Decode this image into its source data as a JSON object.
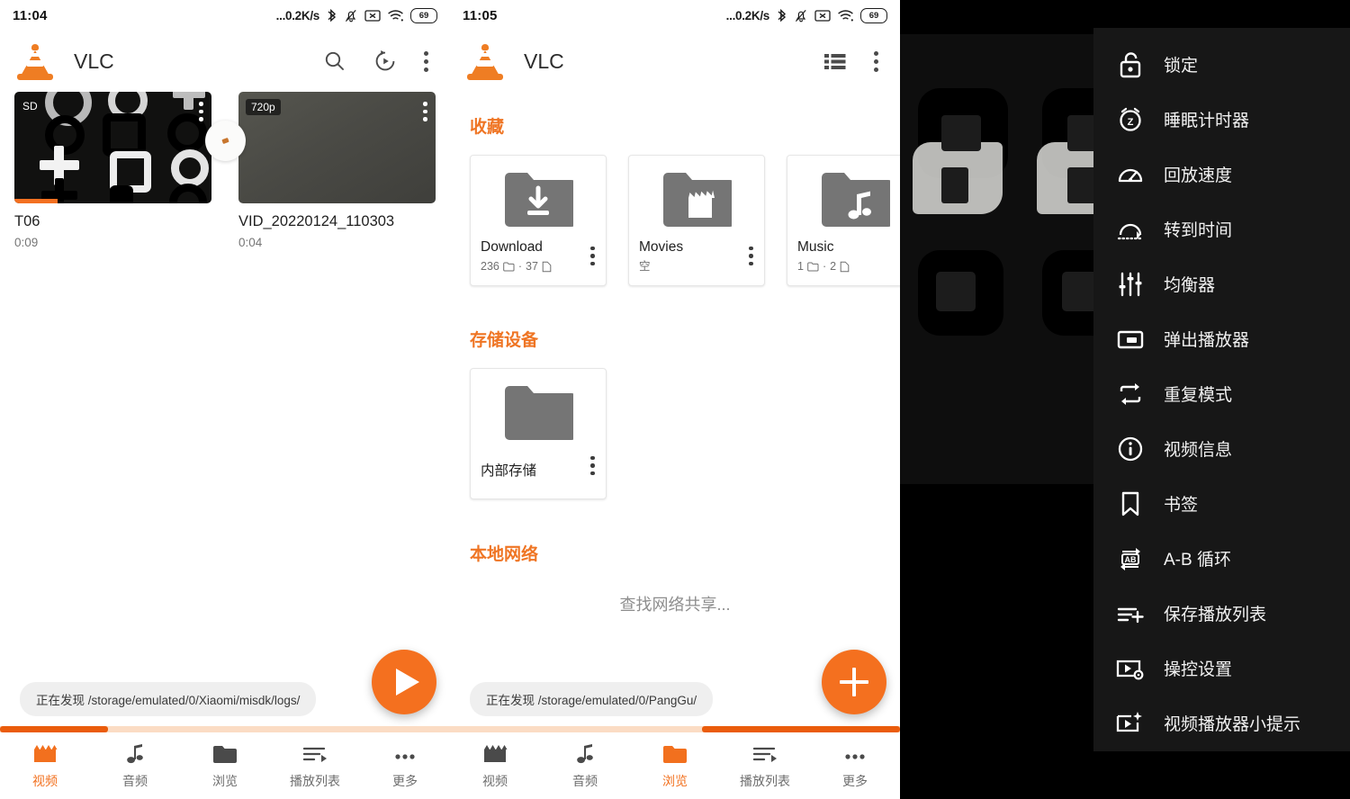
{
  "panel1": {
    "status": {
      "clock": "11:04",
      "netspeed": "...0.2K/s",
      "battery": "69",
      "icons": [
        "bluetooth-icon",
        "bell-muted-icon",
        "sim-x-icon",
        "wifi-icon",
        "battery-icon"
      ]
    },
    "appbar": {
      "title": "VLC",
      "actions": [
        "search-icon",
        "history-icon",
        "overflow-icon"
      ]
    },
    "videos": [
      {
        "name": "T06",
        "duration": "0:09",
        "quality": "SD",
        "progress": true
      },
      {
        "name": "VID_20220124_110303",
        "duration": "0:04",
        "quality": "720p",
        "progress": false
      }
    ],
    "toast": "正在发现 /storage/emulated/0/Xiaomi/misdk/logs/",
    "fab": "play-icon",
    "scroll": {
      "position": "left"
    }
  },
  "panel2": {
    "status": {
      "clock": "11:05",
      "netspeed": "...0.2K/s",
      "battery": "69"
    },
    "appbar": {
      "title": "VLC",
      "actions": [
        "list-view-icon",
        "overflow-icon"
      ]
    },
    "sections": [
      {
        "title": "收藏"
      },
      {
        "title": "存储设备"
      },
      {
        "title": "本地网络"
      }
    ],
    "favorites": [
      {
        "name": "Download",
        "folders": "236",
        "files": "37",
        "icon": "folder-download-icon"
      },
      {
        "name": "Movies",
        "empty": "空",
        "icon": "folder-movie-icon"
      },
      {
        "name": "Music",
        "folders": "1",
        "files": "2",
        "icon": "folder-music-icon"
      }
    ],
    "storage": [
      {
        "name": "内部存储",
        "icon": "folder-icon"
      }
    ],
    "network_message": "查找网络共享...",
    "toast": "正在发现 /storage/emulated/0/PangGu/",
    "fab": "plus-icon",
    "scroll": {
      "position": "right"
    }
  },
  "bottom_nav": [
    {
      "label": "视频",
      "icon": "movie-clapper-icon"
    },
    {
      "label": "音频",
      "icon": "music-note-icon"
    },
    {
      "label": "浏览",
      "icon": "folder-icon"
    },
    {
      "label": "播放列表",
      "icon": "playlist-icon"
    },
    {
      "label": "更多",
      "icon": "more-icon"
    }
  ],
  "bottom_nav_active": {
    "panel1": "视频",
    "panel2": "浏览"
  },
  "player_menu": [
    {
      "label": "锁定",
      "icon": "lock-open-icon"
    },
    {
      "label": "睡眠计时器",
      "icon": "sleep-timer-icon"
    },
    {
      "label": "回放速度",
      "icon": "speedometer-icon"
    },
    {
      "label": "转到时间",
      "icon": "jump-to-time-icon"
    },
    {
      "label": "均衡器",
      "icon": "equalizer-icon"
    },
    {
      "label": "弹出播放器",
      "icon": "popup-player-icon"
    },
    {
      "label": "重复模式",
      "icon": "repeat-icon"
    },
    {
      "label": "视频信息",
      "icon": "info-icon"
    },
    {
      "label": "书签",
      "icon": "bookmark-icon"
    },
    {
      "label": "A-B 循环",
      "icon": "ab-repeat-icon"
    },
    {
      "label": "保存播放列表",
      "icon": "playlist-add-icon"
    },
    {
      "label": "操控设置",
      "icon": "player-settings-icon"
    },
    {
      "label": "视频播放器小提示",
      "icon": "player-tips-icon"
    }
  ],
  "colors": {
    "accent": "#f4701f",
    "accent_dark": "#ea5c0c",
    "menu_bg": "#171717",
    "track": "#fbdcc4"
  }
}
